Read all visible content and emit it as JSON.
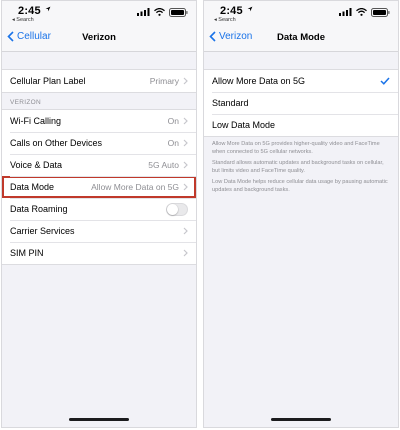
{
  "status_bar": {
    "time": "2:45",
    "back_app": "◂ Search"
  },
  "left": {
    "nav": {
      "back_label": "Cellular",
      "title": "Verizon"
    },
    "top_row": {
      "label": "Cellular Plan Label",
      "value": "Primary"
    },
    "section_header": "VERIZON",
    "rows": [
      {
        "label": "Wi-Fi Calling",
        "value": "On"
      },
      {
        "label": "Calls on Other Devices",
        "value": "On"
      },
      {
        "label": "Voice & Data",
        "value": "5G Auto"
      },
      {
        "label": "Data Mode",
        "value": "Allow More Data on 5G"
      },
      {
        "label": "Data Roaming",
        "value": ""
      },
      {
        "label": "Carrier Services",
        "value": ""
      },
      {
        "label": "SIM PIN",
        "value": ""
      }
    ],
    "data_roaming_on": false,
    "highlight_color": "#c0392b"
  },
  "right": {
    "nav": {
      "back_label": "Verizon",
      "title": "Data Mode"
    },
    "options": [
      {
        "label": "Allow More Data on 5G",
        "selected": true
      },
      {
        "label": "Standard",
        "selected": false
      },
      {
        "label": "Low Data Mode",
        "selected": false
      }
    ],
    "footnotes": [
      "Allow More Data on 5G provides higher-quality video and FaceTime when connected to 5G cellular networks.",
      "Standard allows automatic updates and background tasks on cellular, but limits video and FaceTime quality.",
      "Low Data Mode helps reduce cellular data usage by pausing automatic updates and background tasks."
    ]
  },
  "icons": {
    "location": "location-arrow-icon",
    "signal": "signal-bars-icon",
    "wifi": "wifi-icon",
    "battery": "battery-icon",
    "back": "chevron-left-icon",
    "disclosure": "chevron-right-icon",
    "checkmark": "checkmark-icon"
  },
  "colors": {
    "accent": "#1a73e8",
    "background": "#f2f2f7",
    "secondary_text": "#8e8e93"
  }
}
